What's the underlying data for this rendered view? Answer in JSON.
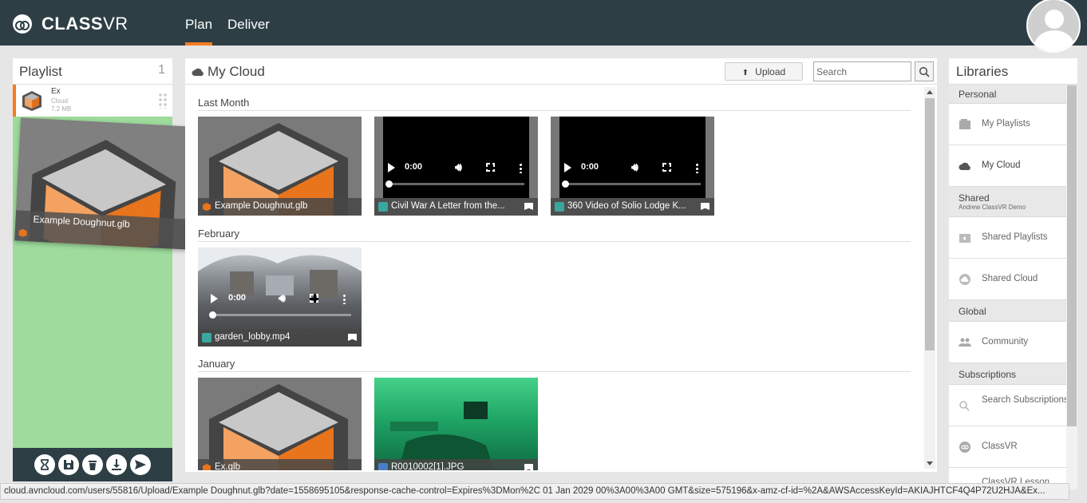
{
  "app": {
    "brand_bold": "CLASS",
    "brand_light": "VR",
    "nav": [
      {
        "label": "Plan",
        "active": true
      },
      {
        "label": "Deliver",
        "active": false
      }
    ]
  },
  "playlist": {
    "title": "Playlist",
    "count": "1",
    "item": {
      "name": "Ex",
      "source": "Cloud",
      "size": "7.2 MB"
    },
    "drag_preview": {
      "label": "Example Doughnut.glb"
    },
    "toolbar": [
      "hourglass-icon",
      "save-icon",
      "trash-icon",
      "download-icon",
      "send-icon"
    ]
  },
  "cloud": {
    "title": "My Cloud",
    "upload_label": "Upload",
    "search_placeholder": "Search",
    "sections": [
      {
        "heading": "Last Month",
        "items": [
          {
            "label": "Example Doughnut.glb",
            "type": "model"
          },
          {
            "label": "Civil War A Letter from the...",
            "type": "video",
            "time": "0:00"
          },
          {
            "label": "360 Video of Solio Lodge K...",
            "type": "video",
            "time": "0:00"
          }
        ]
      },
      {
        "heading": "February",
        "items": [
          {
            "label": "garden_lobby.mp4",
            "type": "video",
            "time": "0:00"
          }
        ]
      },
      {
        "heading": "January",
        "items": [
          {
            "label": "Ex.glb",
            "type": "model"
          },
          {
            "label": "R0010002[1].JPG",
            "type": "image"
          }
        ]
      }
    ]
  },
  "libraries": {
    "title": "Libraries",
    "groups": [
      {
        "label": "Personal",
        "sub": "",
        "items": [
          "My Playlists",
          "My Cloud"
        ]
      },
      {
        "label": "Shared",
        "sub": "Andrew ClassVR Demo",
        "items": [
          "Shared Playlists",
          "Shared Cloud"
        ]
      },
      {
        "label": "Global",
        "sub": "",
        "items": [
          "Community"
        ]
      },
      {
        "label": "Subscriptions",
        "sub": "",
        "items": [
          "Search Subscriptions",
          "ClassVR",
          "ClassVR Lesson..."
        ]
      }
    ]
  },
  "status_url": "cloud.avncloud.com/users/55816/Upload/Example Doughnut.glb?date=1558695105&response-cache-control=Expires%3DMon%2C 01 Jan 2029 00%3A00%3A00 GMT&size=575196&x-amz-cf-id=%2A&AWSAccessKeyId=AKIAJHTCF4Q4P72U2HJA&Ex...",
  "colors": {
    "topbar": "#2d3e45",
    "accent": "#f47c20",
    "playlist_bg": "#9edb9c",
    "teal_icon": "#3aa6a0"
  }
}
